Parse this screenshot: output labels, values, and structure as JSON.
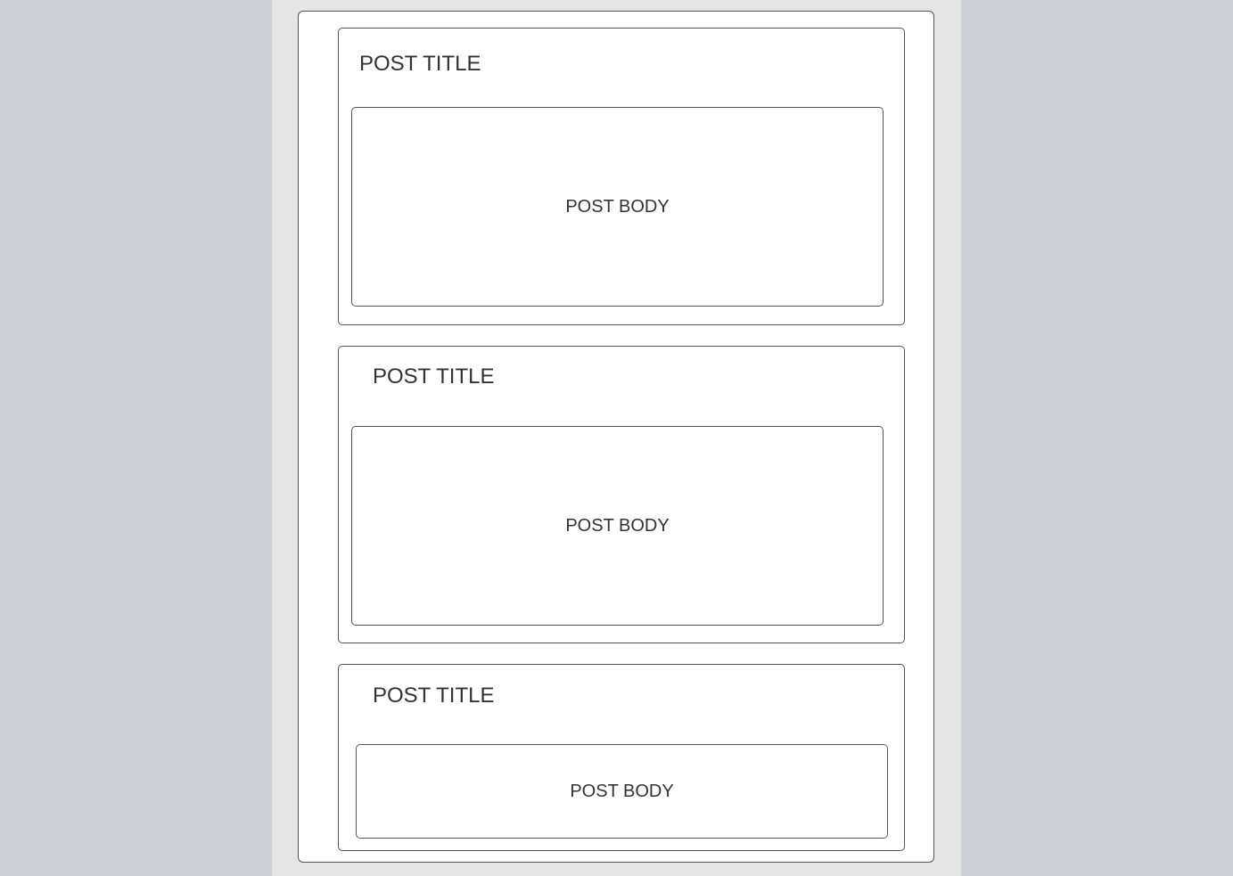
{
  "posts": [
    {
      "title": "POST TITLE",
      "body": "POST BODY"
    },
    {
      "title": "POST TITLE",
      "body": "POST BODY"
    },
    {
      "title": "POST TITLE",
      "body": "POST BODY"
    }
  ],
  "colors": {
    "page_background": "#cbced3",
    "column_background": "#e5e5e5",
    "card_background": "#ffffff",
    "border": "#555555",
    "text": "#333333"
  }
}
